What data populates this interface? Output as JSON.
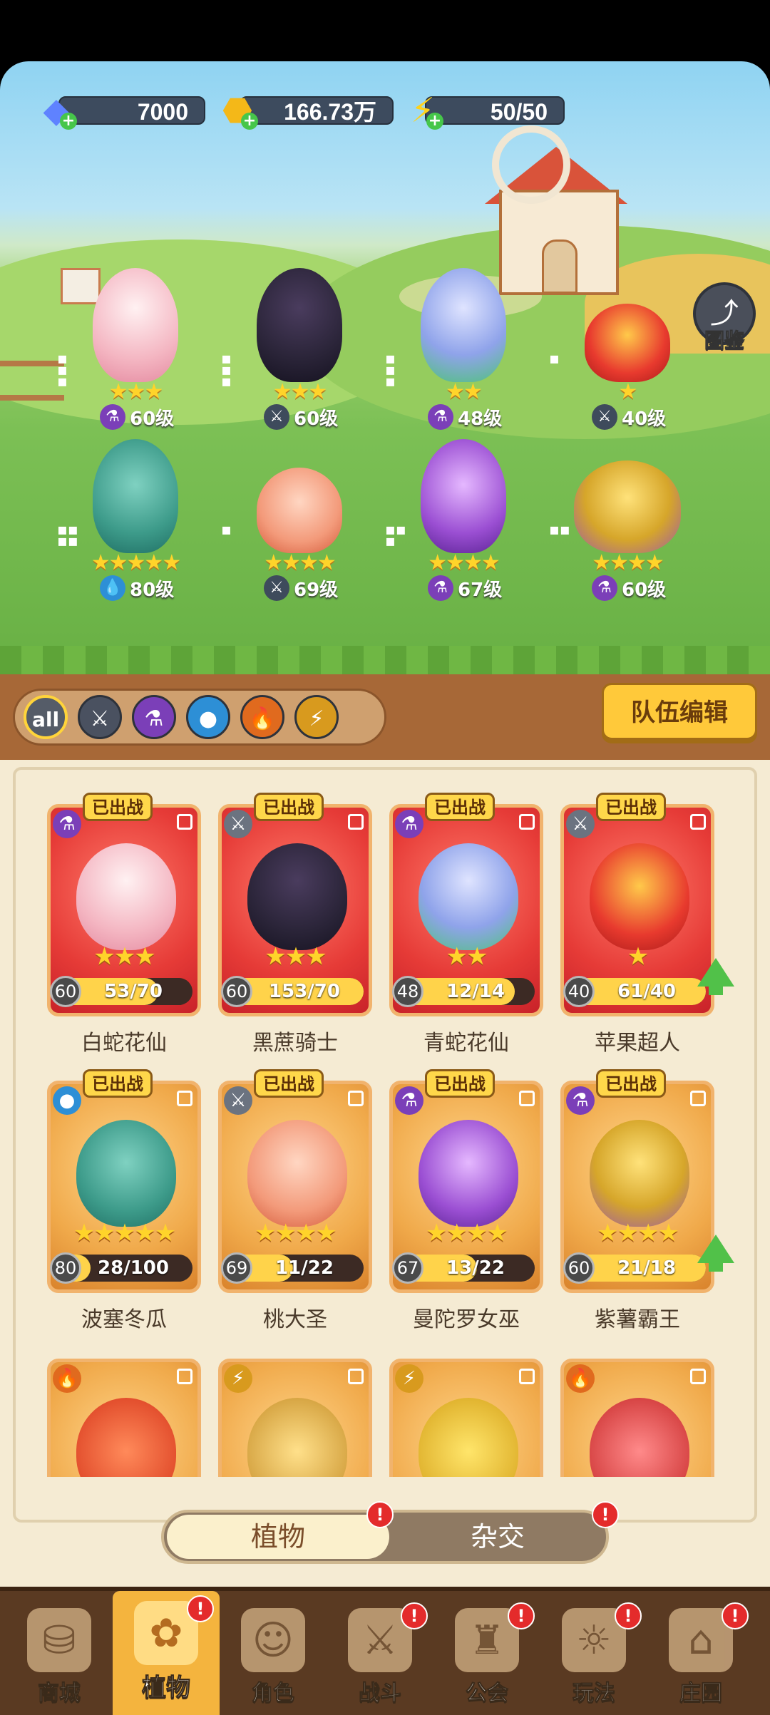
{
  "resources": {
    "gems": "7000",
    "coins": "166.73万",
    "energy": "50/50"
  },
  "atlas_label": "图鉴",
  "team": [
    {
      "stars": "★★★",
      "type": "purple-potion",
      "level": "60级"
    },
    {
      "stars": "★★★",
      "type": "sword",
      "level": "60级"
    },
    {
      "stars": "★★",
      "type": "purple-potion",
      "level": "48级"
    },
    {
      "stars": "★",
      "type": "sword",
      "level": "40级"
    },
    {
      "stars": "★★★★★",
      "type": "water",
      "level": "80级"
    },
    {
      "stars": "★★★★",
      "type": "sword",
      "level": "69级"
    },
    {
      "stars": "★★★★",
      "type": "purple-potion",
      "level": "67级"
    },
    {
      "stars": "★★★★",
      "type": "purple-potion",
      "level": "60级"
    }
  ],
  "filters": [
    "all",
    "sword",
    "potion",
    "water",
    "fire",
    "lightning"
  ],
  "team_edit": "队伍编辑",
  "deployed_label": "已出战",
  "cards": [
    {
      "name": "白蛇花仙",
      "level": "60",
      "progress": "53/70",
      "stars": "★★★",
      "fill": 0.76,
      "theme": "red",
      "type": "purple-potion",
      "upgrade": false
    },
    {
      "name": "黑蔗骑士",
      "level": "60",
      "progress": "153/70",
      "stars": "★★★",
      "fill": 1.0,
      "theme": "red",
      "type": "sword",
      "upgrade": false
    },
    {
      "name": "青蛇花仙",
      "level": "48",
      "progress": "12/14",
      "stars": "★★",
      "fill": 0.86,
      "theme": "red",
      "type": "purple-potion",
      "upgrade": false
    },
    {
      "name": "苹果超人",
      "level": "40",
      "progress": "61/40",
      "stars": "★",
      "fill": 1.0,
      "theme": "red",
      "type": "sword",
      "upgrade": true
    },
    {
      "name": "波塞冬瓜",
      "level": "80",
      "progress": "28/100",
      "stars": "★★★★★",
      "fill": 0.28,
      "theme": "gold",
      "type": "water",
      "upgrade": false
    },
    {
      "name": "桃大圣",
      "level": "69",
      "progress": "11/22",
      "stars": "★★★★",
      "fill": 0.5,
      "theme": "gold",
      "type": "sword",
      "upgrade": false
    },
    {
      "name": "曼陀罗女巫",
      "level": "67",
      "progress": "13/22",
      "stars": "★★★★",
      "fill": 0.59,
      "theme": "gold",
      "type": "purple-potion",
      "upgrade": false
    },
    {
      "name": "紫薯霸王",
      "level": "60",
      "progress": "21/18",
      "stars": "★★★★",
      "fill": 1.0,
      "theme": "gold",
      "type": "purple-potion",
      "upgrade": true
    }
  ],
  "tabs": {
    "plants": "植物",
    "hybrid": "杂交",
    "badge": "!"
  },
  "nav": [
    {
      "label": "商城",
      "icon": "shop-icon",
      "badge": false
    },
    {
      "label": "植物",
      "icon": "plants-icon",
      "badge": true,
      "active": true
    },
    {
      "label": "角色",
      "icon": "character-icon",
      "badge": false
    },
    {
      "label": "战斗",
      "icon": "battle-icon",
      "badge": true
    },
    {
      "label": "公会",
      "icon": "guild-icon",
      "badge": true
    },
    {
      "label": "玩法",
      "icon": "gameplay-icon",
      "badge": true
    },
    {
      "label": "庄园",
      "icon": "manor-icon",
      "badge": true
    }
  ],
  "colors": {
    "accent": "#ffc93a",
    "badge": "#e42b2b",
    "upgrade": "#51c149"
  }
}
